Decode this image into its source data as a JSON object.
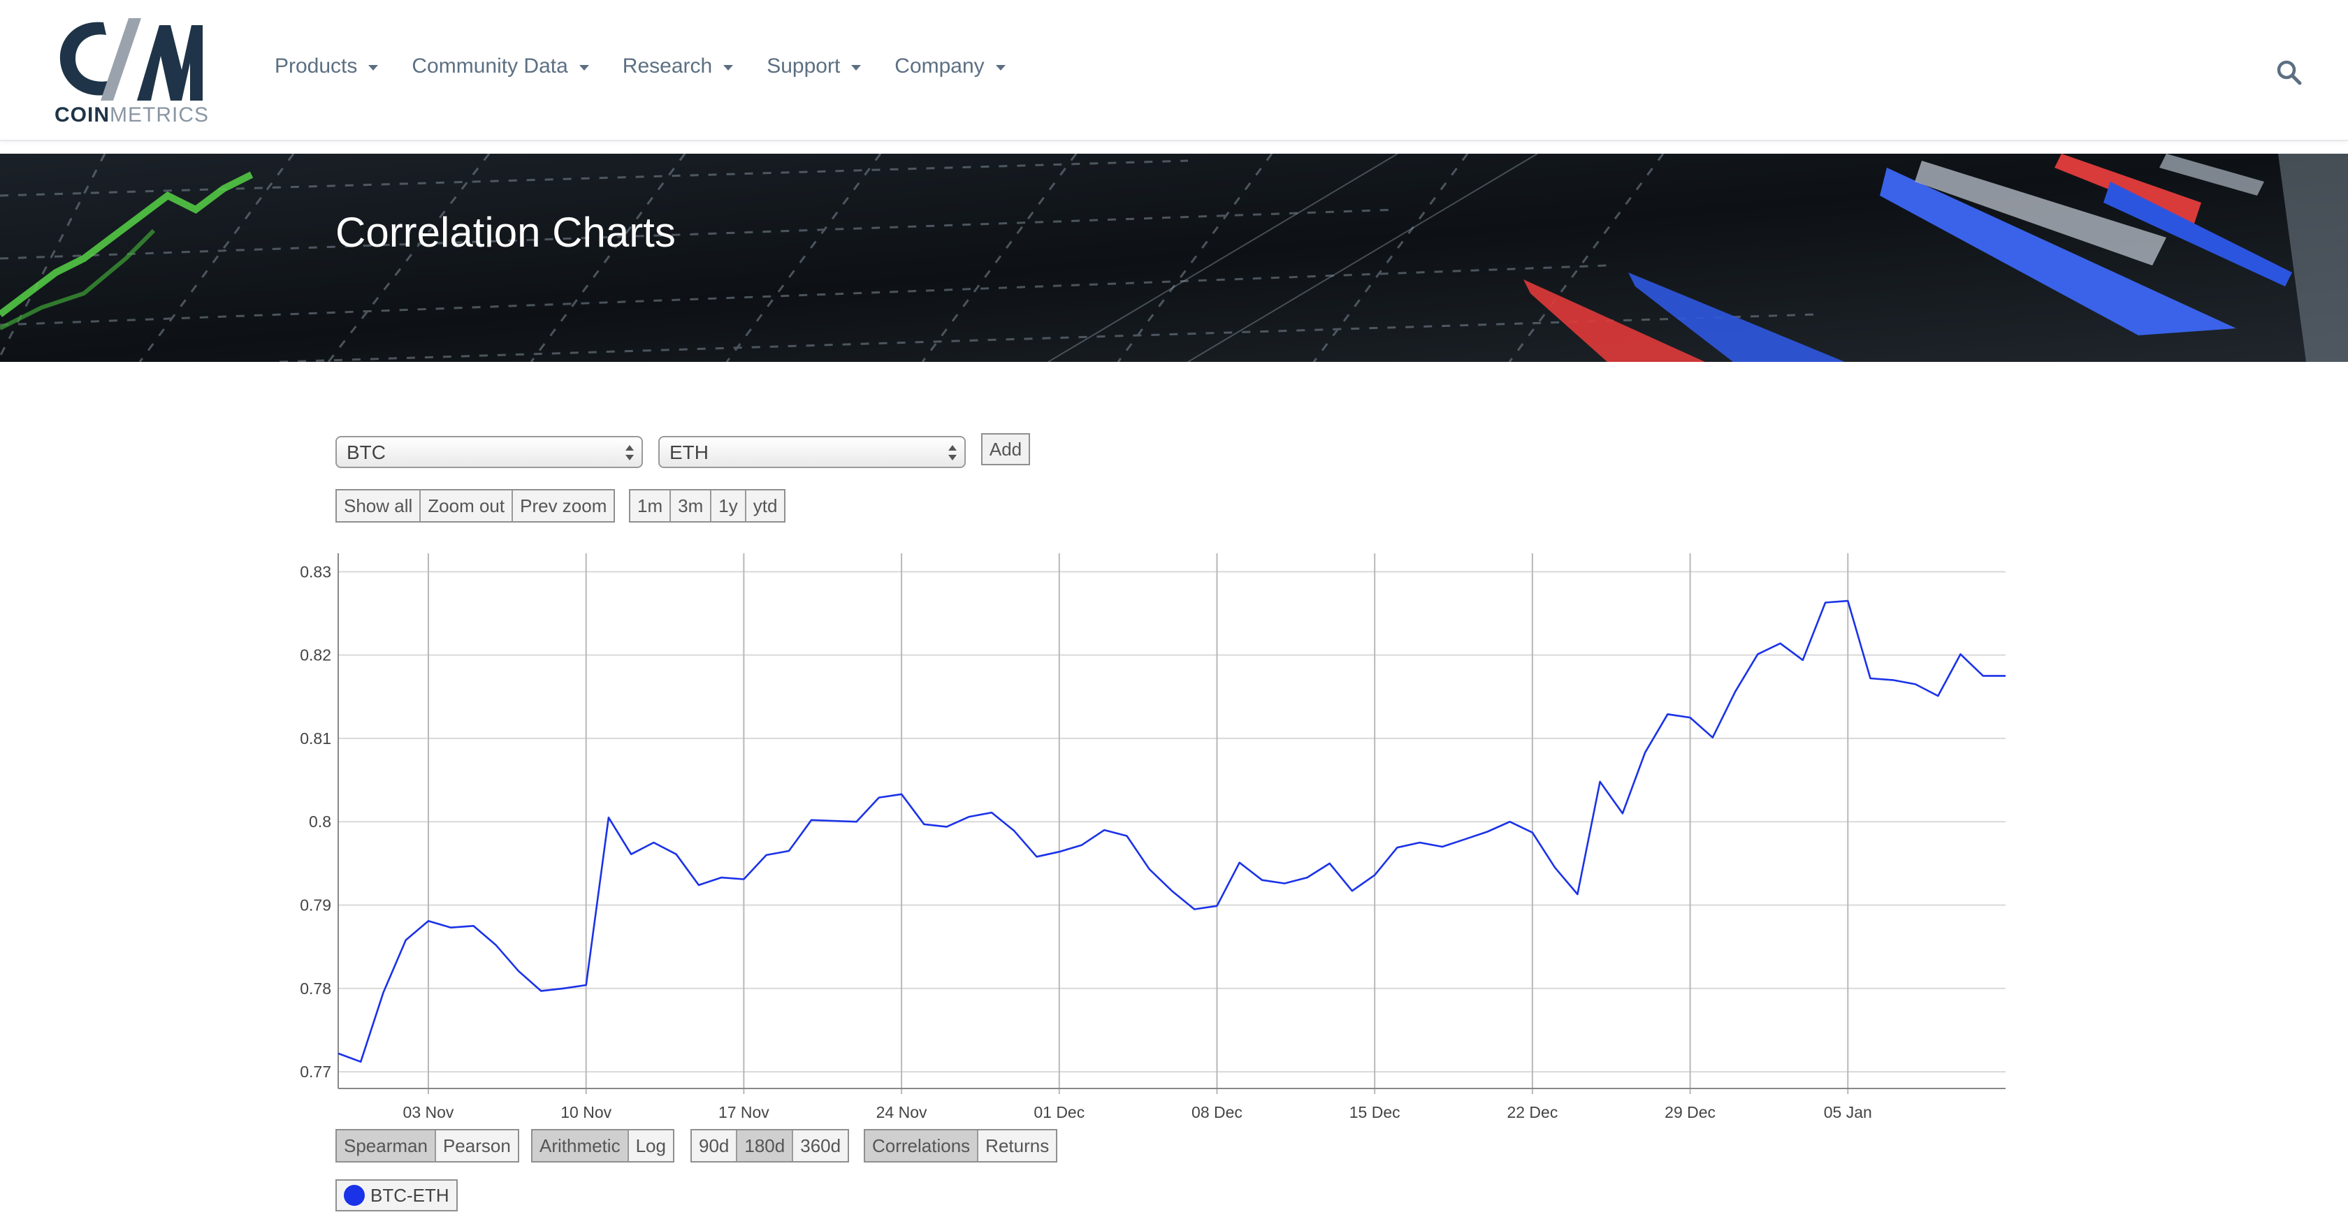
{
  "brand": {
    "logo_bold": "COIN",
    "logo_light": "METRICS"
  },
  "nav": [
    {
      "label": "Products"
    },
    {
      "label": "Community Data"
    },
    {
      "label": "Research"
    },
    {
      "label": "Support"
    },
    {
      "label": "Company"
    }
  ],
  "banner": {
    "title": "Correlation Charts"
  },
  "controls": {
    "asset_a": "BTC",
    "asset_b": "ETH",
    "add_label": "Add",
    "zoom_buttons": [
      "Show all",
      "Zoom out",
      "Prev zoom"
    ],
    "range_buttons": [
      "1m",
      "3m",
      "1y",
      "ytd"
    ]
  },
  "options": {
    "method": {
      "items": [
        "Spearman",
        "Pearson"
      ],
      "selected": "Spearman"
    },
    "scale": {
      "items": [
        "Arithmetic",
        "Log"
      ],
      "selected": "Arithmetic"
    },
    "window": {
      "items": [
        "90d",
        "180d",
        "360d"
      ],
      "selected": "180d"
    },
    "mode": {
      "items": [
        "Correlations",
        "Returns"
      ],
      "selected": "Correlations"
    }
  },
  "legend": {
    "label": "BTC-ETH",
    "color": "#1a32e8"
  },
  "colors": {
    "line": "#1a32e8",
    "grid": "#d9d9d9",
    "vgrid": "#b8b8b8",
    "nav_text": "#5c6f82",
    "logo_dark": "#1f3448"
  },
  "chart_data": {
    "type": "line",
    "title": "",
    "xlabel": "",
    "ylabel": "",
    "ylim": [
      0.7685,
      0.8312
    ],
    "yticks": [
      0.77,
      0.78,
      0.79,
      0.8,
      0.81,
      0.82,
      0.83
    ],
    "ytick_labels": [
      "0.77",
      "0.78",
      "0.79",
      "0.8",
      "0.81",
      "0.82",
      "0.83"
    ],
    "xlim": [
      "2023-10-30",
      "2024-01-12"
    ],
    "xticks": [
      "2023-11-03",
      "2023-11-10",
      "2023-11-17",
      "2023-11-24",
      "2023-12-01",
      "2023-12-08",
      "2023-12-15",
      "2023-12-22",
      "2023-12-29",
      "2024-01-05"
    ],
    "xtick_labels": [
      "03 Nov",
      "10 Nov",
      "17 Nov",
      "24 Nov",
      "01 Dec",
      "08 Dec",
      "15 Dec",
      "22 Dec",
      "29 Dec",
      "05 Jan"
    ],
    "grid": true,
    "series": [
      {
        "name": "BTC-ETH",
        "x": [
          "2023-10-30",
          "2023-10-31",
          "2023-11-01",
          "2023-11-02",
          "2023-11-03",
          "2023-11-04",
          "2023-11-05",
          "2023-11-06",
          "2023-11-07",
          "2023-11-08",
          "2023-11-09",
          "2023-11-10",
          "2023-11-11",
          "2023-11-12",
          "2023-11-13",
          "2023-11-14",
          "2023-11-15",
          "2023-11-16",
          "2023-11-17",
          "2023-11-18",
          "2023-11-19",
          "2023-11-20",
          "2023-11-21",
          "2023-11-22",
          "2023-11-23",
          "2023-11-24",
          "2023-11-25",
          "2023-11-26",
          "2023-11-27",
          "2023-11-28",
          "2023-11-29",
          "2023-11-30",
          "2023-12-01",
          "2023-12-02",
          "2023-12-03",
          "2023-12-04",
          "2023-12-05",
          "2023-12-06",
          "2023-12-07",
          "2023-12-08",
          "2023-12-09",
          "2023-12-10",
          "2023-12-11",
          "2023-12-12",
          "2023-12-13",
          "2023-12-14",
          "2023-12-15",
          "2023-12-16",
          "2023-12-17",
          "2023-12-18",
          "2023-12-19",
          "2023-12-20",
          "2023-12-21",
          "2023-12-22",
          "2023-12-23",
          "2023-12-24",
          "2023-12-25",
          "2023-12-26",
          "2023-12-27",
          "2023-12-28",
          "2023-12-29",
          "2023-12-30",
          "2023-12-31",
          "2024-01-01",
          "2024-01-02",
          "2024-01-03",
          "2024-01-04",
          "2024-01-05",
          "2024-01-06",
          "2024-01-07",
          "2024-01-08",
          "2024-01-09",
          "2024-01-10",
          "2024-01-11",
          "2024-01-12"
        ],
        "values": [
          0.7722,
          0.7712,
          0.7795,
          0.7858,
          0.7881,
          0.7873,
          0.7875,
          0.7852,
          0.7821,
          0.7797,
          0.78,
          0.7804,
          0.8005,
          0.7961,
          0.7975,
          0.7961,
          0.7924,
          0.7933,
          0.7931,
          0.796,
          0.7965,
          0.8002,
          0.8001,
          0.8,
          0.8029,
          0.8033,
          0.7997,
          0.7994,
          0.8006,
          0.8011,
          0.7989,
          0.7958,
          0.7964,
          0.7972,
          0.799,
          0.7983,
          0.7943,
          0.7917,
          0.7895,
          0.7899,
          0.7951,
          0.793,
          0.7926,
          0.7933,
          0.795,
          0.7917,
          0.7936,
          0.7969,
          0.7975,
          0.797,
          0.7979,
          0.7988,
          0.8,
          0.7987,
          0.7945,
          0.7913,
          0.8048,
          0.801,
          0.8083,
          0.8129,
          0.8125,
          0.8101,
          0.8156,
          0.8201,
          0.8214,
          0.8194,
          0.8263,
          0.8265,
          0.8172,
          0.817,
          0.8165,
          0.8151,
          0.8201,
          0.8175,
          0.8175
        ]
      }
    ]
  }
}
